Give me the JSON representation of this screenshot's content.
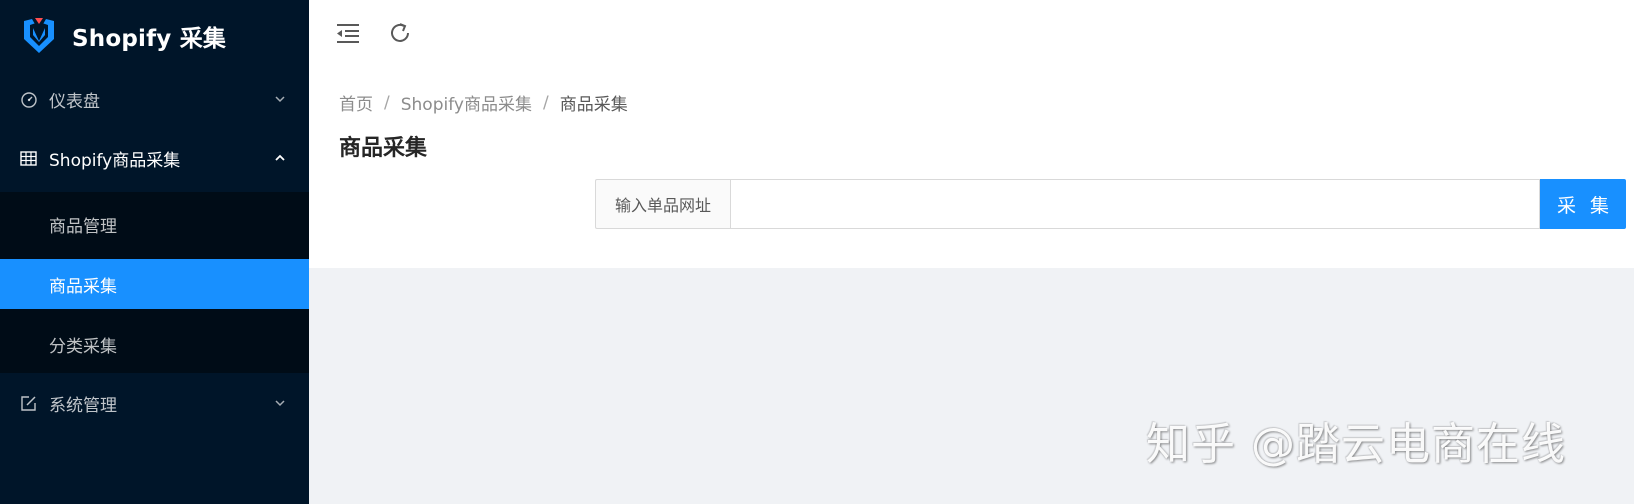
{
  "app": {
    "title": "Shopify 采集"
  },
  "colors": {
    "sidebar_bg": "#001529",
    "submenu_bg": "#000c17",
    "accent": "#1890ff",
    "content_bg": "#f0f2f5"
  },
  "sidebar": {
    "items": [
      {
        "label": "仪表盘",
        "icon": "dashboard-icon",
        "expanded": false
      },
      {
        "label": "Shopify商品采集",
        "icon": "table-icon",
        "expanded": true,
        "children": [
          {
            "label": "商品管理",
            "active": false
          },
          {
            "label": "商品采集",
            "active": true
          },
          {
            "label": "分类采集",
            "active": false
          }
        ]
      },
      {
        "label": "系统管理",
        "icon": "edit-icon",
        "expanded": false
      }
    ]
  },
  "header": {
    "icons": [
      "menu-fold-icon",
      "reload-icon"
    ]
  },
  "breadcrumb": {
    "items": [
      "首页",
      "Shopify商品采集",
      "商品采集"
    ],
    "separator": "/"
  },
  "page": {
    "title": "商品采集",
    "input_addon": "输入单品网址",
    "input_value": "",
    "input_placeholder": "",
    "submit_label": "采 集"
  },
  "watermark": "知乎 @踏云电商在线"
}
